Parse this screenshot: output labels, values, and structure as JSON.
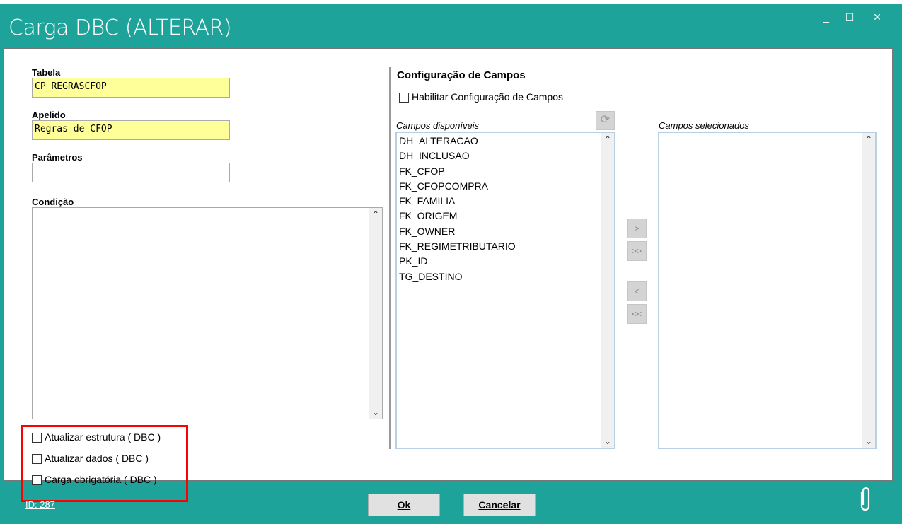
{
  "window": {
    "title": "Carga DBC (ALTERAR)",
    "minimize": "_",
    "maximize": "☐",
    "close": "✕"
  },
  "form": {
    "tabela_label": "Tabela",
    "tabela_value": "CP_REGRASCFOP",
    "apelido_label": "Apelido",
    "apelido_value": "Regras de CFOP",
    "parametros_label": "Parâmetros",
    "parametros_value": "",
    "condicao_label": "Condição",
    "condicao_value": ""
  },
  "options": [
    {
      "label": "Atualizar estrutura ( DBC )",
      "checked": false
    },
    {
      "label": "Atualizar dados ( DBC )",
      "checked": false
    },
    {
      "label": "Carga obrigatória ( DBC )",
      "checked": false
    }
  ],
  "config": {
    "title": "Configuração de Campos",
    "enable_label": "Habilitar Configuração de Campos",
    "available_label": "Campos disponíveis",
    "selected_label": "Campos selecionados",
    "available": [
      "DH_ALTERACAO",
      "DH_INCLUSAO",
      "FK_CFOP",
      "FK_CFOPCOMPRA",
      "FK_FAMILIA",
      "FK_ORIGEM",
      "FK_OWNER",
      "FK_REGIMETRIBUTARIO",
      "PK_ID",
      "TG_DESTINO"
    ],
    "selected": [],
    "move_one": ">",
    "move_all": ">>",
    "remove_one": "<",
    "remove_all": "<<"
  },
  "footer": {
    "id": "ID: 287",
    "ok": "Ok",
    "cancel": "Cancelar"
  },
  "colors": {
    "accent": "#1ea39b",
    "highlight_box": "#ff0000",
    "input_yellow": "#ffff99"
  }
}
